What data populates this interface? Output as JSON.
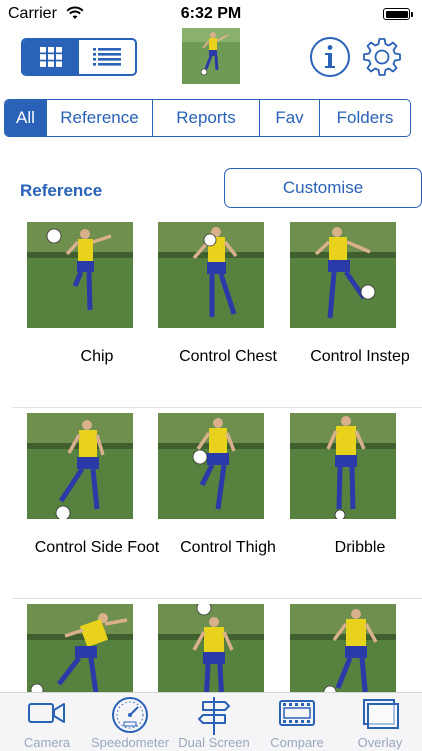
{
  "status_bar": {
    "carrier": "Carrier",
    "time": "6:32 PM"
  },
  "toolbar": {
    "view_modes": [
      "grid-view",
      "list-view"
    ],
    "active_view": "grid-view",
    "icons": [
      "info-icon",
      "gear-icon"
    ]
  },
  "filters": {
    "tabs": [
      "All",
      "Reference",
      "Reports",
      "Fav",
      "Folders"
    ],
    "active": "All"
  },
  "section": {
    "title": "Reference",
    "customise_label": "Customise"
  },
  "grid": {
    "items": [
      {
        "label": "Chip"
      },
      {
        "label": "Control Chest"
      },
      {
        "label": "Control Instep"
      },
      {
        "label": "Control Side Foot"
      },
      {
        "label": "Control Thigh"
      },
      {
        "label": "Dribble"
      },
      {
        "label": ""
      },
      {
        "label": ""
      },
      {
        "label": ""
      }
    ]
  },
  "tab_bar": {
    "items": [
      {
        "label": "Camera",
        "icon": "camera-icon"
      },
      {
        "label": "Speedometer",
        "icon": "speedometer-icon"
      },
      {
        "label": "Dual Screen",
        "icon": "signpost-icon"
      },
      {
        "label": "Compare",
        "icon": "film-strip-icon"
      },
      {
        "label": "Overlay",
        "icon": "overlay-icon"
      }
    ]
  },
  "colors": {
    "accent": "#2a62b8",
    "tab_inactive": "#9aa7bd",
    "grass": "#4f7a3a",
    "shirt": "#e8d21c",
    "shorts": "#2a3aa8"
  }
}
